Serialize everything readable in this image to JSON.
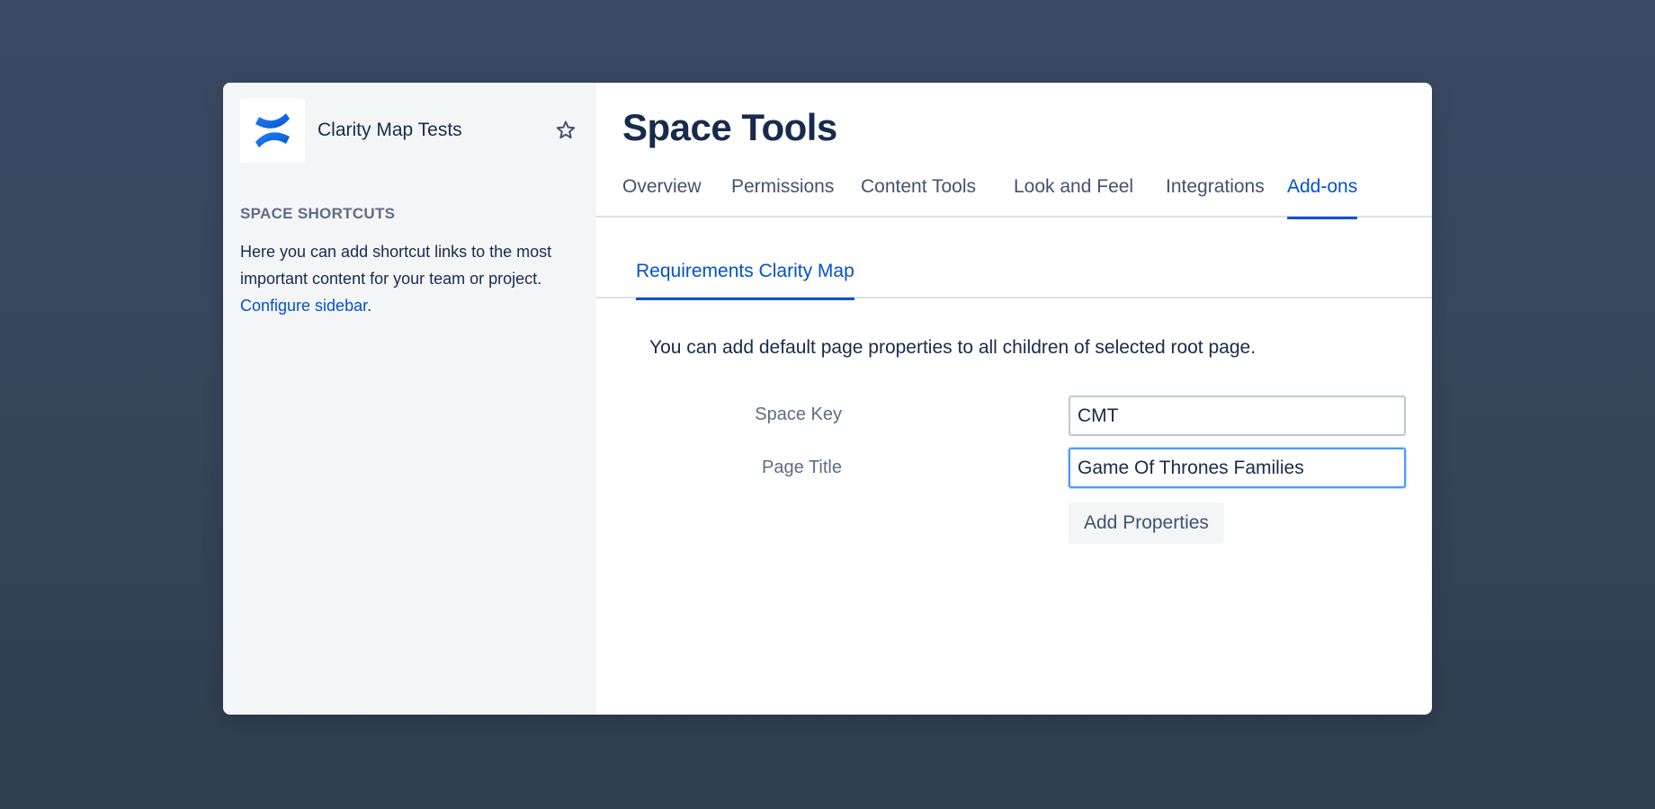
{
  "sidebar": {
    "space_name": "Clarity Map Tests",
    "star_icon": "star-icon",
    "logo_icon": "confluence-logo-icon",
    "shortcuts_heading": "SPACE SHORTCUTS",
    "shortcuts_text": "Here you can add shortcut links to the most important content for your team or project.",
    "configure_link": "Configure sidebar",
    "shortcuts_text_end": "."
  },
  "main": {
    "title": "Space Tools",
    "tabs": [
      {
        "label": "Overview"
      },
      {
        "label": "Permissions"
      },
      {
        "label": "Content Tools"
      },
      {
        "label": "Look and Feel"
      },
      {
        "label": "Integrations"
      },
      {
        "label": "Add-ons",
        "active": true
      }
    ],
    "subtab": "Requirements Clarity Map",
    "description": "You can add default page properties to all children of selected root page.",
    "form": {
      "space_key_label": "Space Key",
      "space_key_value": "CMT",
      "page_title_label": "Page Title",
      "page_title_value": "Game Of Thrones Families",
      "submit_label": "Add Properties"
    }
  },
  "colors": {
    "accent": "#0052cc",
    "focus": "#4c9aff",
    "text": "#172b4d",
    "sidebar_bg": "#f4f5f7"
  }
}
